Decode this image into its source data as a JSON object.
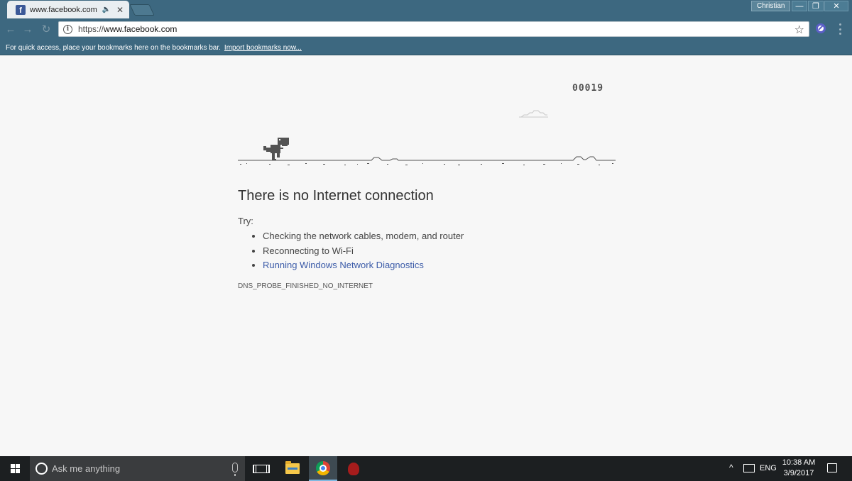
{
  "browser": {
    "tab": {
      "title": "www.facebook.com",
      "favicon_glyph": "f",
      "audio_glyph": "🔈",
      "close_glyph": "✕"
    },
    "profile_name": "Christian",
    "window_controls": {
      "minimize": "—",
      "maximize": "❐",
      "close": "✕"
    },
    "nav": {
      "back": "←",
      "forward": "→",
      "reload": "↻"
    },
    "address": {
      "scheme": "https://",
      "host": "www.facebook.com",
      "info_glyph": "i",
      "star_glyph": "☆"
    },
    "bookmarks_bar": {
      "hint": "For quick access, place your bookmarks here on the bookmarks bar.",
      "import_link": "Import bookmarks now..."
    }
  },
  "page": {
    "score": "00019",
    "title": "There is no Internet connection",
    "try_label": "Try:",
    "suggestions": [
      "Checking the network cables, modem, and router",
      "Reconnecting to Wi-Fi"
    ],
    "diagnostics_link": "Running Windows Network Diagnostics",
    "error_code": "DNS_PROBE_FINISHED_NO_INTERNET"
  },
  "taskbar": {
    "search_placeholder": "Ask me anything",
    "tray_up": "^",
    "language": "ENG",
    "time": "10:38 AM",
    "date": "3/9/2017"
  },
  "colors": {
    "chrome_frame": "#3d6880",
    "page_bg": "#f7f7f7",
    "link": "#3b5ba8",
    "dino": "#535353",
    "taskbar": "#1c1f21"
  },
  "icons": [
    "facebook-favicon-icon",
    "audio-icon",
    "close-icon",
    "info-icon",
    "star-icon",
    "extension-icon",
    "menu-icon",
    "windows-logo-icon",
    "cortana-icon",
    "mic-icon",
    "task-view-icon",
    "folder-icon",
    "chrome-icon",
    "network-icon",
    "notification-icon"
  ]
}
